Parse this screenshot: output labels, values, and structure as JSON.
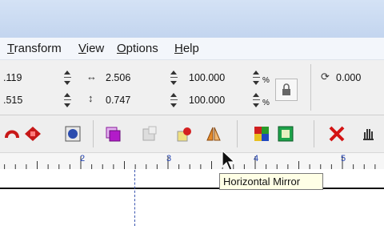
{
  "menubar": {
    "items": [
      {
        "label": "Transform",
        "accel": "T",
        "rest": "ransform"
      },
      {
        "label": "View",
        "accel": "V",
        "rest": "iew"
      },
      {
        "label": "Options",
        "accel": "O",
        "rest": "ptions"
      },
      {
        "label": "Help",
        "accel": "H",
        "rest": "elp"
      }
    ]
  },
  "property_bar": {
    "x_value": ".119",
    "y_value": ".515",
    "width_value": "2.506",
    "height_value": "0.747",
    "scale_x": "100.000",
    "scale_y": "100.000",
    "percent_unit": "%",
    "rotation_value": "0.000"
  },
  "toolbar": {
    "icons": [
      "curve-icon",
      "red-shape-icon",
      "weld-icon",
      "purple-bin-icon",
      "trim-icon",
      "intersect-icon",
      "horizontal-mirror-icon",
      "palette-icon",
      "green-square-icon",
      "delete-x-icon",
      "hand-tool-icon"
    ]
  },
  "ruler": {
    "labels": [
      "2",
      "3",
      "4",
      "5"
    ]
  },
  "tooltip": {
    "text": "Horizontal Mirror"
  },
  "colors": {
    "titlebar": "#c9daf2",
    "ruler_numbers": "#1e3fb0",
    "tooltip_bg": "#ffffe6"
  }
}
